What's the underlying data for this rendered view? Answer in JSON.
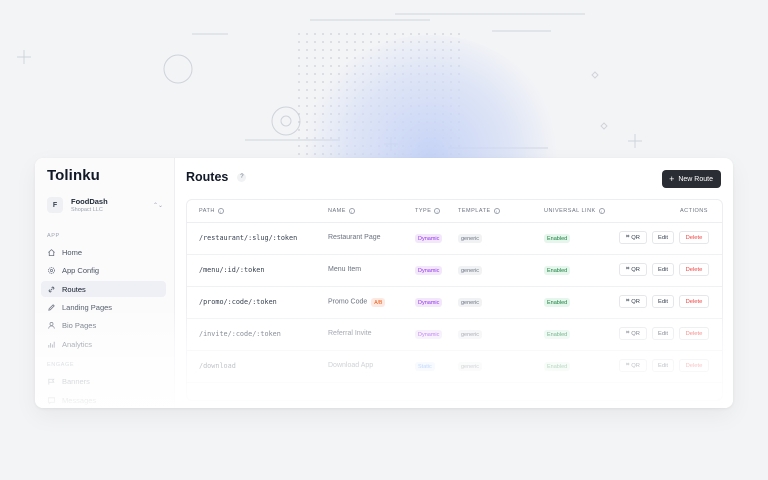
{
  "app": {
    "logo": "Tolinku"
  },
  "org": {
    "avatar": "F",
    "name": "FoodDash",
    "sub": "Shopact LLC"
  },
  "sidebar": {
    "sections": [
      {
        "label": "APP",
        "items": [
          {
            "label": "Home",
            "icon": "home-icon"
          },
          {
            "label": "App Config",
            "icon": "gear-icon"
          },
          {
            "label": "Routes",
            "icon": "link-icon",
            "active": true
          },
          {
            "label": "Landing Pages",
            "icon": "pen-icon"
          },
          {
            "label": "Bio Pages",
            "icon": "user-icon"
          },
          {
            "label": "Analytics",
            "icon": "chart-icon"
          }
        ]
      },
      {
        "label": "ENGAGE",
        "items": [
          {
            "label": "Banners",
            "icon": "banner-icon"
          },
          {
            "label": "Messages",
            "icon": "message-icon"
          }
        ]
      }
    ]
  },
  "page": {
    "title": "Routes",
    "help": "?",
    "new_route": "New Route",
    "new_route_plus": "+"
  },
  "table": {
    "columns": {
      "path": "PATH",
      "name": "NAME",
      "type": "TYPE",
      "template": "TEMPLATE",
      "universal_link": "UNIVERSAL LINK",
      "actions": "ACTIONS"
    },
    "rows": [
      {
        "path": "/restaurant/:slug/:token",
        "name": "Restaurant Page",
        "type": "Dynamic",
        "template": "generic",
        "universal_link": "Enabled"
      },
      {
        "path": "/menu/:id/:token",
        "name": "Menu Item",
        "type": "Dynamic",
        "template": "generic",
        "universal_link": "Enabled"
      },
      {
        "path": "/promo/:code/:token",
        "name": "Promo Code",
        "tag": "A/B",
        "type": "Dynamic",
        "template": "generic",
        "universal_link": "Enabled"
      },
      {
        "path": "/invite/:code/:token",
        "name": "Referral Invite",
        "type": "Dynamic",
        "template": "generic",
        "universal_link": "Enabled"
      },
      {
        "path": "/download",
        "name": "Download App",
        "type": "Static",
        "template": "generic",
        "universal_link": "Enabled"
      }
    ],
    "actions": {
      "qr": "QR",
      "edit": "Edit",
      "delete": "Delete"
    }
  }
}
